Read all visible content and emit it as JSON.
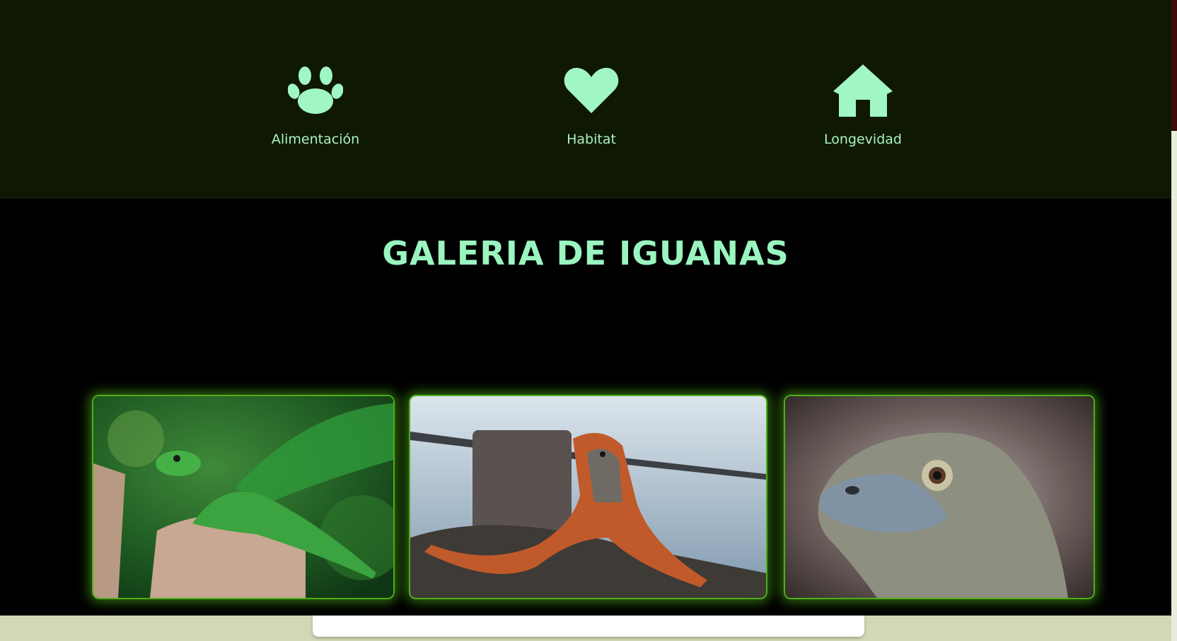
{
  "features": [
    {
      "icon": "paw-icon",
      "label": "Alimentación"
    },
    {
      "icon": "heart-icon",
      "label": "Habitat"
    },
    {
      "icon": "house-icon",
      "label": "Longevidad"
    }
  ],
  "gallery": {
    "title": "GALERIA DE IGUANAS",
    "images": [
      {
        "subject": "green iguana on tree stump"
      },
      {
        "subject": "orange iguana by the water"
      },
      {
        "subject": "close-up of grey iguana head"
      }
    ]
  },
  "colors": {
    "features_bg": "#0f1803",
    "gallery_bg": "#000000",
    "accent": "#9af5bf",
    "card_glow": "#4fae16",
    "page_bg": "#d2d8b6"
  }
}
